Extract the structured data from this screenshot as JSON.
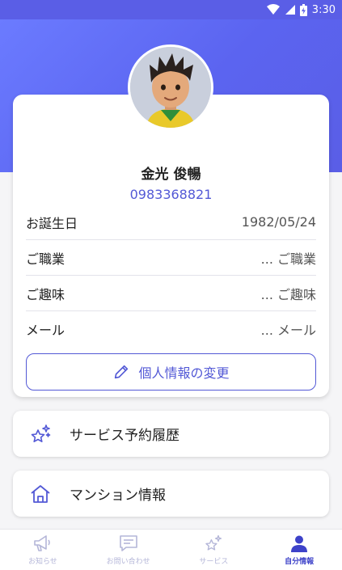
{
  "status_bar": {
    "time": "3:30"
  },
  "profile": {
    "name": "金光 俊暢",
    "phone": "0983368821",
    "fields": [
      {
        "label": "お誕生日",
        "value": "1982/05/24"
      },
      {
        "label": "ご職業",
        "value": "... ご職業"
      },
      {
        "label": "ご趣味",
        "value": "... ご趣味"
      },
      {
        "label": "メール",
        "value": "... メール"
      }
    ],
    "edit_label": "個人情報の変更"
  },
  "menu": {
    "service_history": "サービス予約履歴",
    "apartment_info": "マンション情報"
  },
  "bottom_nav": {
    "items": [
      {
        "label": "お知らせ",
        "icon": "megaphone-icon",
        "active": false
      },
      {
        "label": "お問い合わせ",
        "icon": "message-icon",
        "active": false
      },
      {
        "label": "サービス",
        "icon": "sparkle-star-icon",
        "active": false
      },
      {
        "label": "自分情報",
        "icon": "person-icon",
        "active": true
      }
    ]
  },
  "colors": {
    "accent": "#5359d6",
    "header_gradient_start": "#6b7bff",
    "header_gradient_end": "#5a5ee6",
    "nav_inactive": "#b4b6d8",
    "nav_active": "#3d42c9"
  }
}
